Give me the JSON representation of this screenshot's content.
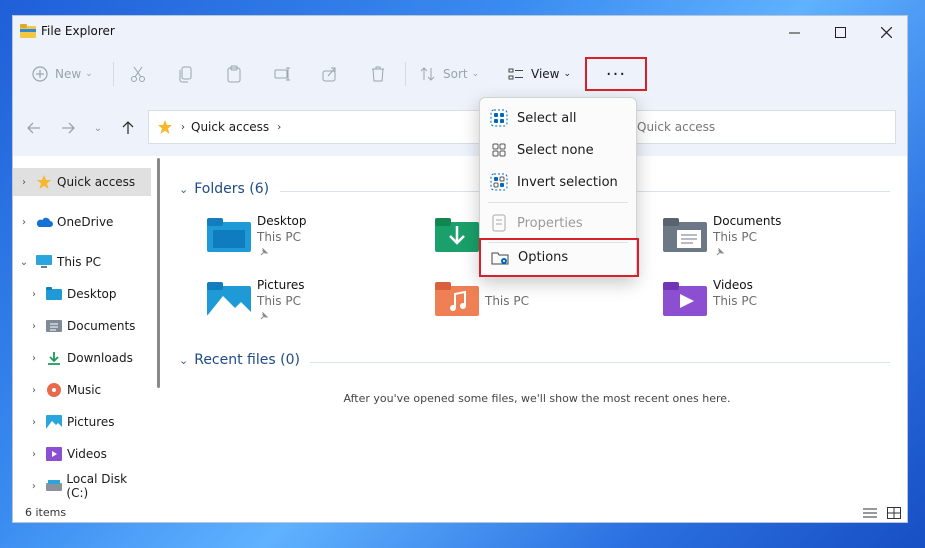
{
  "window": {
    "title": "File Explorer"
  },
  "toolbar": {
    "new_label": "New",
    "sort_label": "Sort",
    "view_label": "View",
    "more_label": "···"
  },
  "address": {
    "crumb": "Quick access"
  },
  "search": {
    "placeholder": "Quick access"
  },
  "sidebar": {
    "items": [
      {
        "label": "Quick access"
      },
      {
        "label": "OneDrive"
      },
      {
        "label": "This PC"
      },
      {
        "label": "Desktop"
      },
      {
        "label": "Documents"
      },
      {
        "label": "Downloads"
      },
      {
        "label": "Music"
      },
      {
        "label": "Pictures"
      },
      {
        "label": "Videos"
      },
      {
        "label": "Local Disk (C:)"
      }
    ]
  },
  "content": {
    "folders_heading": "Folders (6)",
    "recent_heading": "Recent files (0)",
    "recent_empty": "After you've opened some files, we'll show the most recent ones here.",
    "folders": [
      {
        "name": "Desktop",
        "location": "This PC"
      },
      {
        "name": "",
        "location": ""
      },
      {
        "name": "Documents",
        "location": "This PC"
      },
      {
        "name": "Pictures",
        "location": "This PC"
      },
      {
        "name": "",
        "location": "This PC"
      },
      {
        "name": "Videos",
        "location": "This PC"
      }
    ]
  },
  "menu": {
    "items": [
      {
        "label": "Select all"
      },
      {
        "label": "Select none"
      },
      {
        "label": "Invert selection"
      },
      {
        "label": "Properties"
      },
      {
        "label": "Options"
      }
    ]
  },
  "status": {
    "count": "6 items"
  },
  "colors": {
    "accent": "#0067c0",
    "highlight_border": "#d8202a",
    "folder_blue": "#1e9ad6"
  }
}
